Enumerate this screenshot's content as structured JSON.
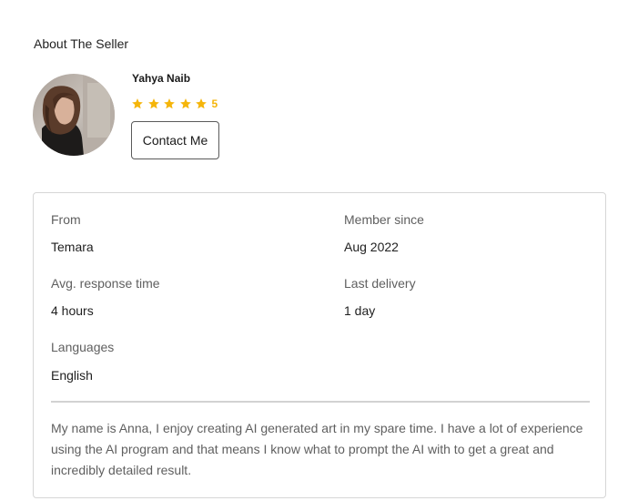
{
  "seller_section": {
    "title": "About The Seller",
    "name": "Yahya Naib",
    "rating_value": "5",
    "rating_stars": 5,
    "contact_label": "Contact Me",
    "avatar": "seller-photo"
  },
  "details": {
    "from_label": "From",
    "from_value": "Temara",
    "member_since_label": "Member since",
    "member_since_value": "Aug 2022",
    "response_label": "Avg. response time",
    "response_value": "4 hours",
    "last_delivery_label": "Last delivery",
    "last_delivery_value": "1 day",
    "languages_label": "Languages",
    "languages_value": "English"
  },
  "bio": "My name is Anna, I enjoy creating AI generated art in my spare time. I have a lot of experience using the AI program and that means I know what to prompt the AI with to get a great and incredibly detailed result.",
  "colors": {
    "star": "#f5b50a",
    "border": "#d6d6d6",
    "muted_text": "#5f5f5f"
  }
}
